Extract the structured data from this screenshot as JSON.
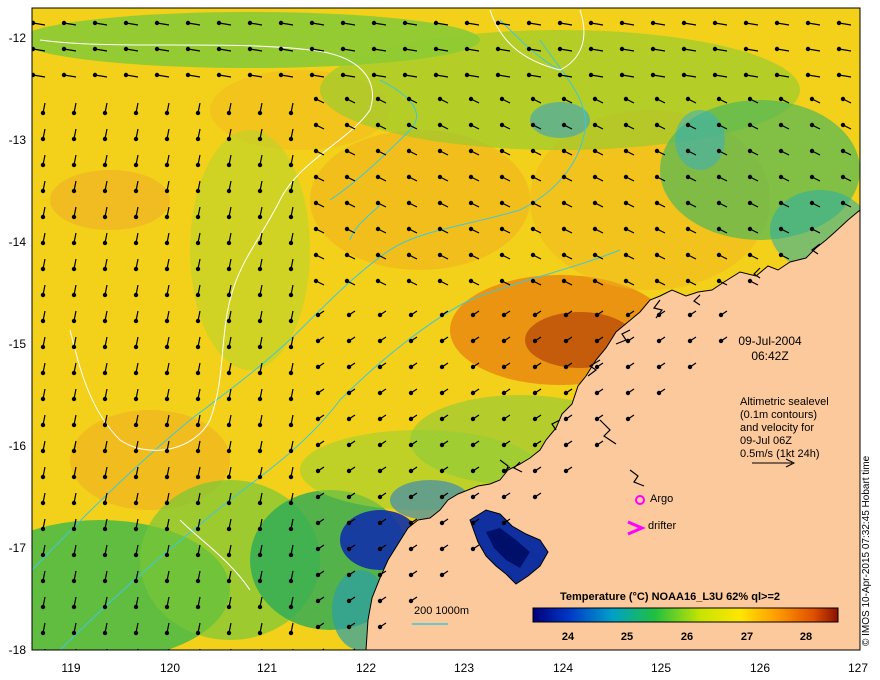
{
  "map": {
    "y_ticks": [
      "-12",
      "-13",
      "-14",
      "-15",
      "-16",
      "-17",
      "-18"
    ],
    "x_ticks": [
      "119",
      "120",
      "121",
      "122",
      "123",
      "124",
      "125",
      "126",
      "127"
    ],
    "date_line1": "09-Jul-2004",
    "date_line2": "06:42Z",
    "legend_lines": [
      "Altimetric sealevel",
      "(0.1m contours)",
      "and velocity for",
      "09-Jul 06Z",
      "0.5m/s (1kt 24h)"
    ],
    "argo_label": "Argo",
    "drifter_label": "drifter",
    "isobath_label": "200  1000m",
    "colorbar_title": "Temperature (°C) NOAA16_L3U 62% ql>=2",
    "colorbar_ticks": [
      "24",
      "25",
      "26",
      "27",
      "28"
    ],
    "credit": "© IMOS 10-Apr-2015 07:32:45 Hobart time",
    "colors": {
      "land": "#fbc99c",
      "isobath": "#3cc8dc",
      "sealevel_contour": "#ffffff",
      "argo": "#ff00ff",
      "drifter": "#ff00ff",
      "vectors": "#000000"
    }
  }
}
